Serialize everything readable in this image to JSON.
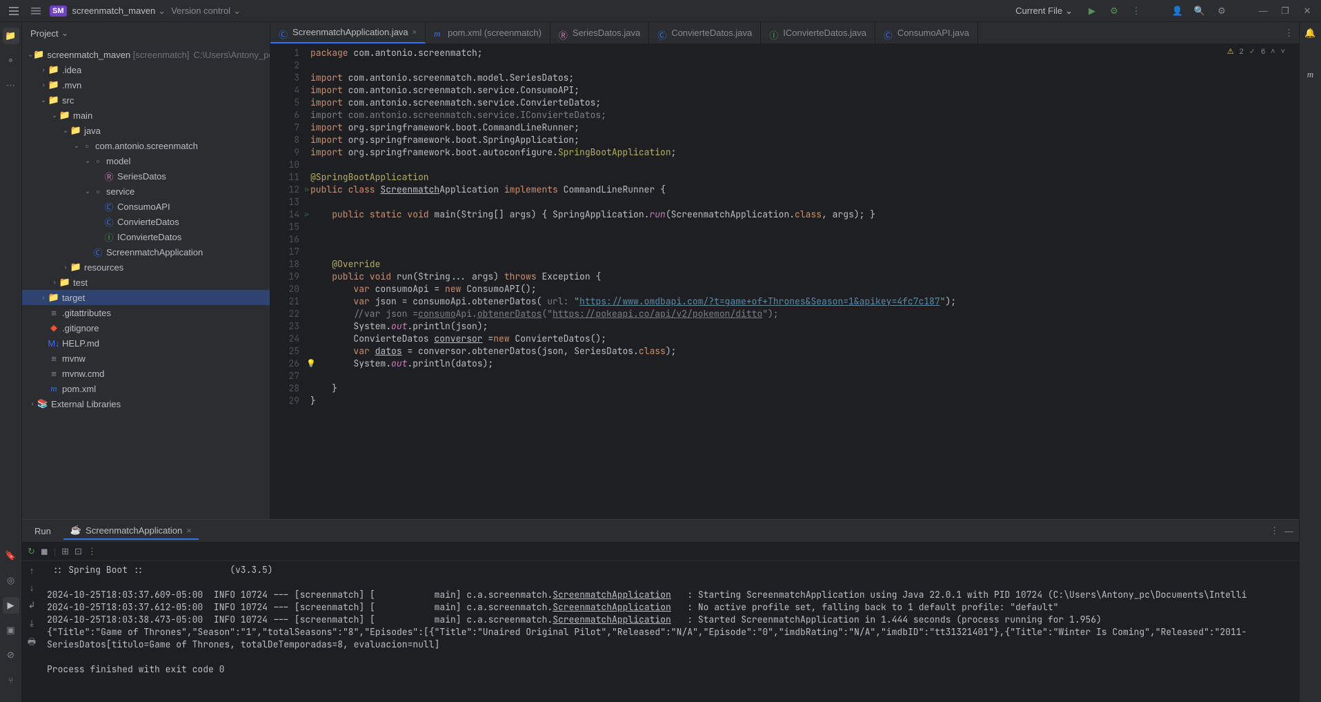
{
  "titlebar": {
    "project_badge": "SM",
    "project_name": "screenmatch_maven",
    "vcs_label": "Version control",
    "run_config": "Current File"
  },
  "project": {
    "header": "Project",
    "tree": [
      {
        "depth": 0,
        "arrow": "down",
        "icon": "folder",
        "label": "screenmatch_maven",
        "suffix": "[screenmatch]",
        "hint": "C:\\Users\\Antony_pc\\Docum..."
      },
      {
        "depth": 1,
        "arrow": "right",
        "icon": "folder",
        "label": ".idea"
      },
      {
        "depth": 1,
        "arrow": "right",
        "icon": "folder",
        "label": ".mvn"
      },
      {
        "depth": 1,
        "arrow": "down",
        "icon": "folder-src",
        "label": "src"
      },
      {
        "depth": 2,
        "arrow": "down",
        "icon": "folder",
        "label": "main"
      },
      {
        "depth": 3,
        "arrow": "down",
        "icon": "folder-src",
        "label": "java"
      },
      {
        "depth": 4,
        "arrow": "down",
        "icon": "package",
        "label": "com.antonio.screenmatch"
      },
      {
        "depth": 5,
        "arrow": "down",
        "icon": "package",
        "label": "model"
      },
      {
        "depth": 6,
        "arrow": "none",
        "icon": "record",
        "label": "SeriesDatos"
      },
      {
        "depth": 5,
        "arrow": "down",
        "icon": "package",
        "label": "service"
      },
      {
        "depth": 6,
        "arrow": "none",
        "icon": "class",
        "label": "ConsumoAPI"
      },
      {
        "depth": 6,
        "arrow": "none",
        "icon": "class",
        "label": "ConvierteDatos"
      },
      {
        "depth": 6,
        "arrow": "none",
        "icon": "interface",
        "label": "IConvierteDatos"
      },
      {
        "depth": 5,
        "arrow": "none",
        "icon": "class",
        "label": "ScreenmatchApplication"
      },
      {
        "depth": 3,
        "arrow": "right",
        "icon": "folder-res",
        "label": "resources"
      },
      {
        "depth": 2,
        "arrow": "right",
        "icon": "folder-test",
        "label": "test"
      },
      {
        "depth": 1,
        "arrow": "right",
        "icon": "folder-ex",
        "label": "target",
        "selected": true
      },
      {
        "depth": 1,
        "arrow": "none",
        "icon": "file",
        "label": ".gitattributes"
      },
      {
        "depth": 1,
        "arrow": "none",
        "icon": "git",
        "label": ".gitignore"
      },
      {
        "depth": 1,
        "arrow": "none",
        "icon": "md",
        "label": "HELP.md"
      },
      {
        "depth": 1,
        "arrow": "none",
        "icon": "file",
        "label": "mvnw"
      },
      {
        "depth": 1,
        "arrow": "none",
        "icon": "file",
        "label": "mvnw.cmd"
      },
      {
        "depth": 1,
        "arrow": "none",
        "icon": "maven",
        "label": "pom.xml"
      },
      {
        "depth": 0,
        "arrow": "right",
        "icon": "lib",
        "label": "External Libraries"
      }
    ]
  },
  "tabs": [
    {
      "icon": "class",
      "label": "ScreenmatchApplication.java",
      "active": true,
      "closable": true
    },
    {
      "icon": "maven",
      "label": "pom.xml (screenmatch)"
    },
    {
      "icon": "record",
      "label": "SeriesDatos.java"
    },
    {
      "icon": "class",
      "label": "ConvierteDatos.java"
    },
    {
      "icon": "interface",
      "label": "IConvierteDatos.java"
    },
    {
      "icon": "class",
      "label": "ConsumoAPI.java"
    }
  ],
  "editor_status": {
    "warnings": "2",
    "checks": "6"
  },
  "code_lines": [
    {
      "n": 1,
      "html": "<span class='kw'>package</span> com.antonio.screenmatch;"
    },
    {
      "n": 2,
      "html": ""
    },
    {
      "n": 3,
      "html": "<span class='kw'>import</span> com.antonio.screenmatch.model.SeriesDatos;"
    },
    {
      "n": 4,
      "html": "<span class='kw'>import</span> com.antonio.screenmatch.service.ConsumoAPI;"
    },
    {
      "n": 5,
      "html": "<span class='kw'>import</span> com.antonio.screenmatch.service.ConvierteDatos;"
    },
    {
      "n": 6,
      "html": "<span class='cmt'>import com.antonio.screenmatch.service.IConvierteDatos;</span>"
    },
    {
      "n": 7,
      "html": "<span class='kw'>import</span> org.springframework.boot.CommandLineRunner;"
    },
    {
      "n": 8,
      "html": "<span class='kw'>import</span> org.springframework.boot.SpringApplication;"
    },
    {
      "n": 9,
      "html": "<span class='kw'>import</span> org.springframework.boot.autoconfigure.<span class='ann'>SpringBootApplication</span>;"
    },
    {
      "n": 10,
      "html": ""
    },
    {
      "n": 11,
      "html": "<span class='ann'>@SpringBootApplication</span>"
    },
    {
      "n": 12,
      "html": "<span class='kw'>public class</span> <span style='text-decoration:underline'>Screenmatch</span>Application <span class='kw'>implements</span> CommandLineRunner {",
      "run": true
    },
    {
      "n": 13,
      "html": ""
    },
    {
      "n": 14,
      "html": "    <span class='kw'>public static void</span> <span class='cls'>main</span>(String[] args) { SpringApplication.<span class='fld'>run</span>(ScreenmatchApplication.<span class='kw'>class</span>, args); }",
      "run": true
    },
    {
      "n": 15,
      "html": ""
    },
    {
      "n": 16,
      "html": ""
    },
    {
      "n": 17,
      "html": ""
    },
    {
      "n": 18,
      "html": "    <span class='ann'>@Override</span>"
    },
    {
      "n": 19,
      "html": "    <span class='kw'>public void</span> <span class='cls'>run</span>(String... args) <span class='kw'>throws</span> Exception {"
    },
    {
      "n": 20,
      "html": "        <span class='kw'>var</span> consumoApi = <span class='kw'>new</span> ConsumoAPI();"
    },
    {
      "n": 21,
      "html": "        <span class='kw'>var</span> json = consumoApi.obtenerDatos( <span class='cmt'>url:</span> <span class='str'>\"</span><span class='url'>https://www.omdbapi.com/?t=game+of+Thrones&Season=1&apikey=4fc7c187</span><span class='str'>\"</span>);"
    },
    {
      "n": 22,
      "html": "        <span class='cmt'>//var json =</span><span class='cmt' style='text-decoration:underline'>consumo</span><span class='cmt'>Api.</span><span class='cmt' style='text-decoration:underline'>obtenerDatos</span><span class='cmt'>(\"</span><span class='cmt' style='text-decoration:underline'>https://pokeapi.co/api/v2/pokemon/ditto</span><span class='cmt'>\");</span>"
    },
    {
      "n": 23,
      "html": "        System.<span class='fld'>out</span>.println(json);"
    },
    {
      "n": 24,
      "html": "        ConvierteDatos <span style='text-decoration:underline'>conversor</span> =<span class='kw'>new</span> ConvierteDatos();"
    },
    {
      "n": 25,
      "html": "        <span class='kw'>var</span> <span style='text-decoration:underline'>datos</span> = conversor.obtenerDatos(json, SeriesDatos.<span class='kw'>class</span>);"
    },
    {
      "n": 26,
      "html": "        System.<span class='fld'>out</span>.println(datos);",
      "bulb": true
    },
    {
      "n": 27,
      "html": ""
    },
    {
      "n": 28,
      "html": "    }"
    },
    {
      "n": 29,
      "html": "}"
    }
  ],
  "run": {
    "tab_label": "Run",
    "config_name": "ScreenmatchApplication",
    "console": [
      " :: Spring Boot ::                (v3.3.5)",
      "",
      "2024-10-25T18:03:37.609-05:00  INFO 10724 --- [screenmatch] [           main] c.a.screenmatch.<u>ScreenmatchApplication</u>   : Starting ScreenmatchApplication using Java 22.0.1 with PID 10724 (C:\\Users\\Antony_pc\\Documents\\Intelli",
      "2024-10-25T18:03:37.612-05:00  INFO 10724 --- [screenmatch] [           main] c.a.screenmatch.<u>ScreenmatchApplication</u>   : No active profile set, falling back to 1 default profile: \"default\"",
      "2024-10-25T18:03:38.473-05:00  INFO 10724 --- [screenmatch] [           main] c.a.screenmatch.<u>ScreenmatchApplication</u>   : Started ScreenmatchApplication in 1.444 seconds (process running for 1.956)",
      "{\"Title\":\"Game of Thrones\",\"Season\":\"1\",\"totalSeasons\":\"8\",\"Episodes\":[{\"Title\":\"Unaired Original Pilot\",\"Released\":\"N/A\",\"Episode\":\"0\",\"imdbRating\":\"N/A\",\"imdbID\":\"tt31321401\"},{\"Title\":\"Winter Is Coming\",\"Released\":\"2011-",
      "SeriesDatos[titulo=Game of Thrones, totalDeTemporadas=8, evaluacion=null]",
      "",
      "Process finished with exit code 0"
    ]
  }
}
